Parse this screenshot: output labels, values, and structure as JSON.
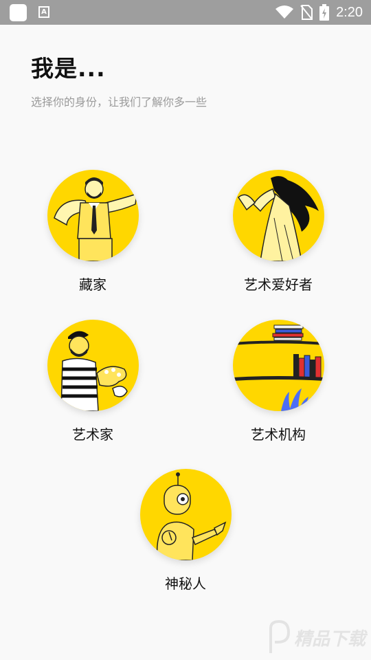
{
  "status_bar": {
    "time": "2:20",
    "a_icon_letter": "A",
    "icons": [
      "app-icon",
      "a-icon",
      "wifi-icon",
      "no-sim-icon",
      "battery-charging-icon"
    ]
  },
  "header": {
    "title": "我是...",
    "subtitle": "选择你的身份，让我们了解你多一些"
  },
  "identities": [
    {
      "label": "藏家",
      "icon": "collector-illustration"
    },
    {
      "label": "艺术爱好者",
      "icon": "art-lover-illustration"
    },
    {
      "label": "艺术家",
      "icon": "artist-illustration"
    },
    {
      "label": "艺术机构",
      "icon": "art-institution-illustration"
    },
    {
      "label": "神秘人",
      "icon": "mystery-person-illustration"
    }
  ],
  "colors": {
    "accent_yellow": "#ffd700",
    "status_bar": "#9e9e9e",
    "background": "#f9f9f9",
    "subtitle_gray": "#9a9a9a"
  },
  "watermark": {
    "text": "精品下载"
  }
}
